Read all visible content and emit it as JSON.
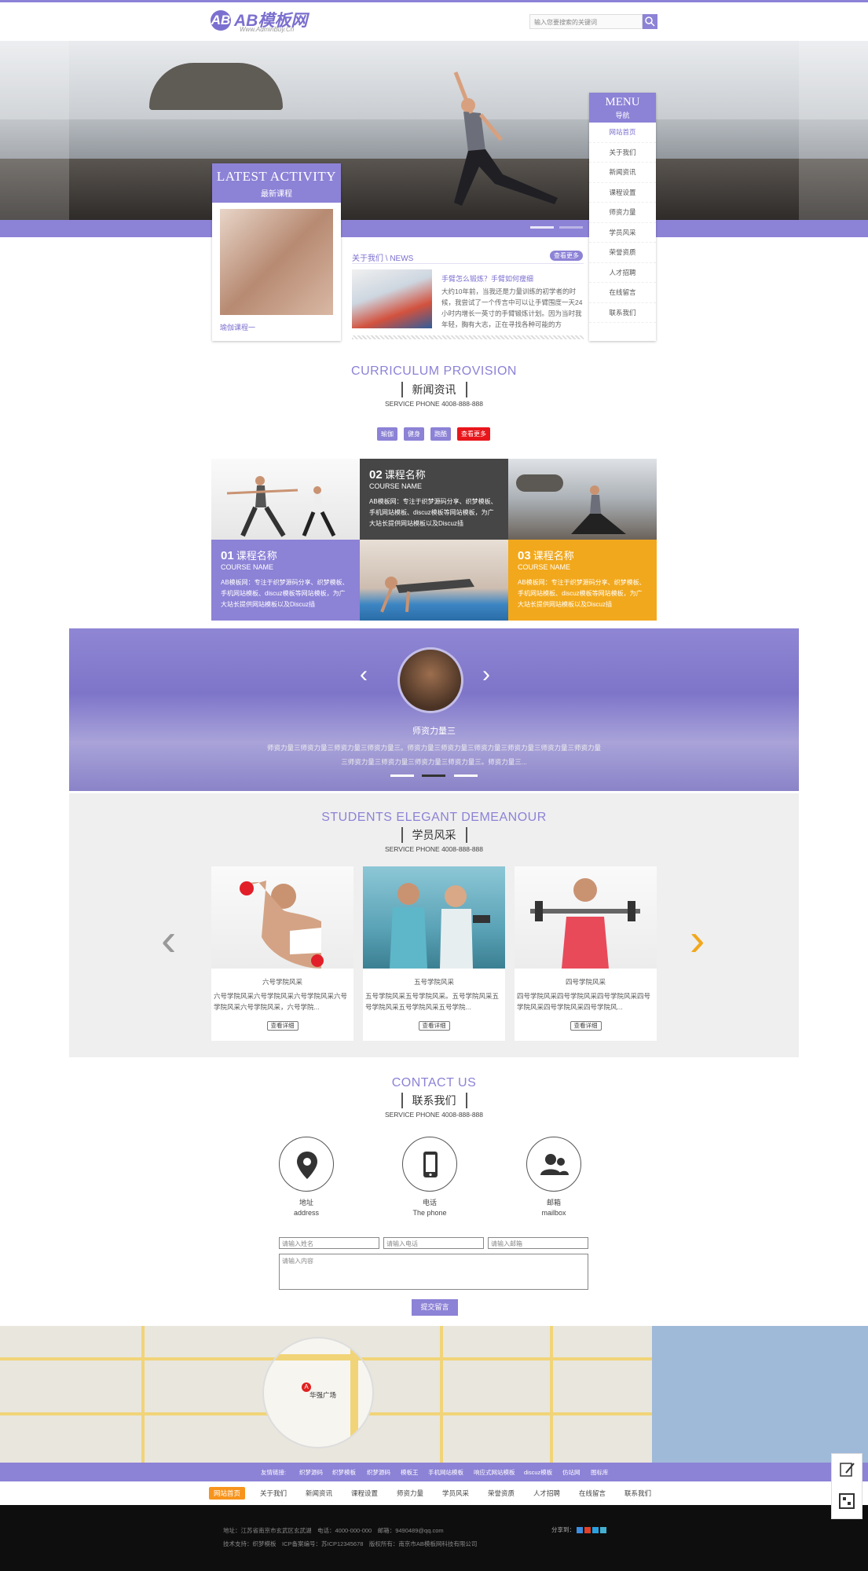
{
  "header": {
    "logo_letters": "AB",
    "logo_text": "AB模板网",
    "logo_sub": "Www.AdminBuy.Cn",
    "search_placeholder": "输入您要搜索的关键词",
    "search_icon": "search-icon"
  },
  "hero": {
    "slide_dots": 2
  },
  "latest": {
    "title_en": "LATEST ACTIVITY",
    "title_cn": "最新课程",
    "caption": "瑜伽课程一"
  },
  "news": {
    "title": "关于我们 \\ NEWS",
    "more": "查看更多",
    "headline": "手臂怎么锻炼？手臂如何瘦细",
    "body": "大约10年前，当我还是力量训练的初学者的时候，我尝试了一个传言中可以让手臂围度一天24小时内增长一英寸的手臂锻炼计划。因为当时我年轻，胸有大志，正在寻找各种可能的方"
  },
  "menu": {
    "title_en": "MENU",
    "title_cn": "导航",
    "items": [
      "网站首页",
      "关于我们",
      "新闻资讯",
      "课程设置",
      "师资力量",
      "学员风采",
      "荣誉资质",
      "人才招聘",
      "在线留言",
      "联系我们"
    ]
  },
  "curriculum": {
    "title_en": "CURRICULUM PROVISION",
    "title_cn": "新闻资讯",
    "phone": "SERVICE PHONE 4008-888-888",
    "tags": [
      "瑜伽",
      "健身",
      "跑酷",
      "查看更多"
    ],
    "courses": [
      {
        "num": "02",
        "name": "课程名称",
        "name_en": "COURSE NAME",
        "desc": "AB模板网：专注于织梦源码分享、织梦模板、手机网站模板、discuz模板等网站模板，为广大站长提供网站模板以及Discuz插"
      },
      {
        "num": "01",
        "name": "课程名称",
        "name_en": "COURSE NAME",
        "desc": "AB模板网：专注于织梦源码分享、织梦模板、手机网站模板、discuz模板等网站模板，为广大站长提供网站模板以及Discuz插"
      },
      {
        "num": "03",
        "name": "课程名称",
        "name_en": "COURSE NAME",
        "desc": "AB模板网：专注于织梦源码分享、织梦模板、手机网站模板、discuz模板等网站模板，为广大站长提供网站模板以及Discuz插"
      }
    ]
  },
  "teachers": {
    "name": "师资力量三",
    "desc": "师资力量三师资力量三师资力量三师资力量三。师资力量三师资力量三师资力量三师资力量三师资力量三师资力量三师资力量三师资力量三师资力量三师资力量三。师资力量三..."
  },
  "students": {
    "title_en": "STUDENTS ELEGANT DEMEANOUR",
    "title_cn": "学员风采",
    "phone": "SERVICE PHONE 4008-888-888",
    "cards": [
      {
        "title": "六号学院风采",
        "desc": "六号学院风采六号学院风采六号学院风采六号学院风采六号学院风采，六号学院...",
        "button": "查看详细"
      },
      {
        "title": "五号学院风采",
        "desc": "五号学院风采五号学院风采。五号学院风采五号学院风采五号学院风采五号学院...",
        "button": "查看详细"
      },
      {
        "title": "四号学院风采",
        "desc": "四号学院风采四号学院风采四号学院风采四号学院风采四号学院风采四号学院风...",
        "button": "查看详细"
      }
    ]
  },
  "contact": {
    "title_en": "CONTACT US",
    "title_cn": "联系我们",
    "phone": "SERVICE PHONE 4008-888-888",
    "items": [
      {
        "cn": "地址",
        "en": "address",
        "icon": "location-pin-icon"
      },
      {
        "cn": "电话",
        "en": "The phone",
        "icon": "phone-icon"
      },
      {
        "cn": "邮箱",
        "en": "mailbox",
        "icon": "users-icon"
      }
    ],
    "name_placeholder": "请输入姓名",
    "phone_placeholder": "请输入电话",
    "email_placeholder": "请输入邮箱",
    "content_placeholder": "请输入内容",
    "submit": "提交留言"
  },
  "map": {
    "place": "华强广场",
    "marker": "A"
  },
  "links": [
    "友情链接:",
    "织梦源码",
    "织梦模板",
    "织梦源码",
    "模板王",
    "手机网站模板",
    "响应式网站模板",
    "discuz模板",
    "仿站网",
    "图标库"
  ],
  "footer_nav": [
    "网站首页",
    "关于我们",
    "新闻资讯",
    "课程设置",
    "师资力量",
    "学员风采",
    "荣誉资质",
    "人才招聘",
    "在线留言",
    "联系我们"
  ],
  "footer": {
    "line1": "地址：江苏省南京市玄武区玄武湖　电话：4000-000-000　邮箱：9490489@qq.com",
    "line2": "技术支持：织梦模板　ICP备案编号：苏ICP12345678　版权所有：南京市AB模板网科技有限公司",
    "share": "分享到："
  },
  "colors": {
    "accent": "#8c82d6",
    "orange": "#f7941d",
    "red": "#e8161b",
    "dark": "#464646",
    "gold": "#f2a81c"
  }
}
